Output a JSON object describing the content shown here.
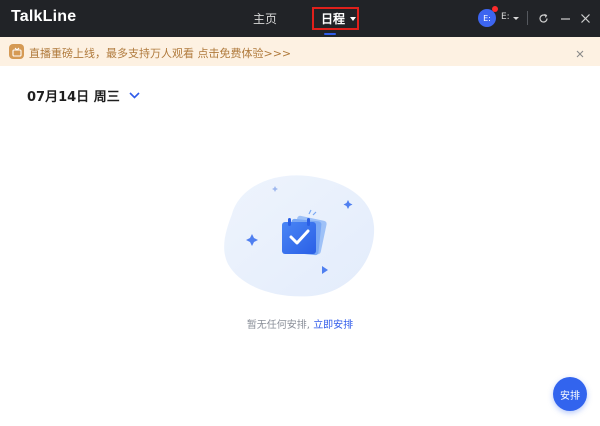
{
  "app": {
    "title": "TalkLine"
  },
  "nav": {
    "home_label": "主页",
    "schedule_label": "日程"
  },
  "user": {
    "avatar_letter": "E:",
    "name": "E:"
  },
  "banner": {
    "text": "直播重磅上线，最多支持万人观看 点击免费体验>>>"
  },
  "date_header": {
    "text": "07月14日 周三"
  },
  "empty_state": {
    "message": "暂无任何安排,",
    "action_link": "立即安排"
  },
  "fab": {
    "label": "安排"
  },
  "colors": {
    "titlebar_bg": "#212327",
    "accent": "#3264ee",
    "highlight_border": "#e0201b",
    "banner_bg": "#fdf1e2",
    "banner_text": "#b07a3c"
  }
}
